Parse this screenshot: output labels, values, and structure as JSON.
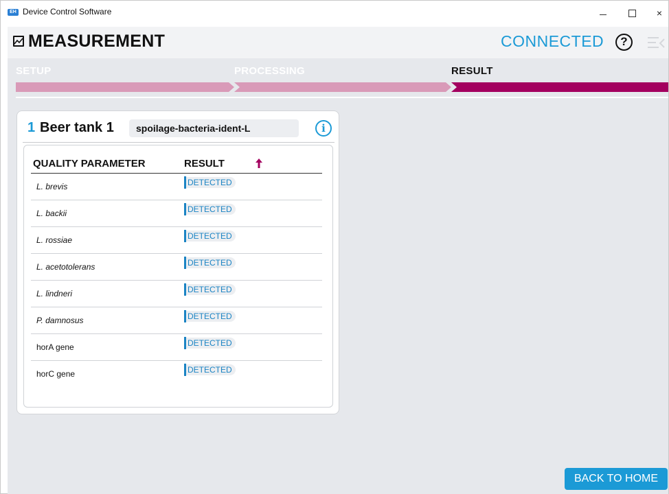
{
  "window": {
    "title": "Device Control Software",
    "icon": "app-logo-icon",
    "controls": {
      "minimize": "minimize-icon",
      "maximize": "maximize-icon",
      "close": "×"
    }
  },
  "header": {
    "icon": "measurement-icon",
    "title": "MEASUREMENT",
    "status": "CONNECTED",
    "help_label": "?",
    "menu_icon": "collapse-menu-icon"
  },
  "steps": [
    {
      "label": "SETUP",
      "state": "done",
      "color": "#d99ab8"
    },
    {
      "label": "PROCESSING",
      "state": "done",
      "color": "#d99ab8"
    },
    {
      "label": "RESULT",
      "state": "active",
      "color": "#a3005f"
    }
  ],
  "card": {
    "index": "1",
    "name": "Beer tank 1",
    "method": "spoilage-bacteria-ident-L",
    "info_label": "i",
    "columns": {
      "param": "QUALITY PARAMETER",
      "result": "RESULT"
    },
    "sort_icon": "sort-arrow-up-icon",
    "rows": [
      {
        "param": "L. brevis",
        "italic": true,
        "result": "DETECTED"
      },
      {
        "param": "L. backii",
        "italic": true,
        "result": "DETECTED"
      },
      {
        "param": "L. rossiae",
        "italic": true,
        "result": "DETECTED"
      },
      {
        "param": "L. acetotolerans",
        "italic": true,
        "result": "DETECTED"
      },
      {
        "param": "L. lindneri",
        "italic": true,
        "result": "DETECTED"
      },
      {
        "param": "P. damnosus",
        "italic": true,
        "result": "DETECTED"
      },
      {
        "param": "horA gene",
        "italic": false,
        "result": "DETECTED"
      },
      {
        "param": "horC gene",
        "italic": false,
        "result": "DETECTED"
      }
    ]
  },
  "footer": {
    "back_home": "BACK TO HOME"
  },
  "colors": {
    "accent_blue": "#1b9ad6",
    "step_done": "#d99ab8",
    "step_active": "#a3005f",
    "background": "#e6e8ec"
  }
}
